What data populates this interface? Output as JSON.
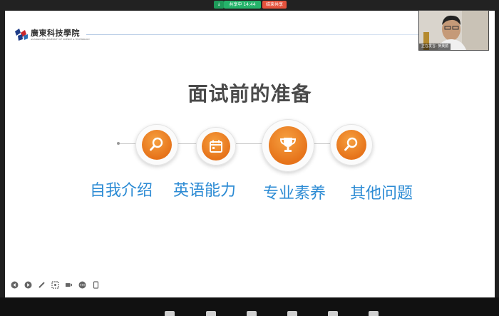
{
  "share_bar": {
    "status": "共享中 14:44",
    "stop": "结束共享"
  },
  "slide": {
    "logo_cn": "廣東科技學院",
    "logo_en": "GUANGDONG UNIVERSITY OF SCIENCE & TECHNOLOGY",
    "title": "面试前的准备",
    "topics": [
      {
        "label": "自我介绍",
        "icon": "search-icon"
      },
      {
        "label": "英语能力",
        "icon": "calendar-icon"
      },
      {
        "label": "专业素养",
        "icon": "trophy-icon"
      },
      {
        "label": "其他问题",
        "icon": "search-icon"
      }
    ],
    "accent_color": "#e6731a",
    "label_color": "#2c8bd4",
    "tools": [
      "prev-icon",
      "next-icon",
      "pen-icon",
      "screenshot-icon",
      "camera-icon",
      "more-icon",
      "tablet-icon"
    ]
  },
  "video": {
    "caption": "正在发言: 贺美韵"
  }
}
